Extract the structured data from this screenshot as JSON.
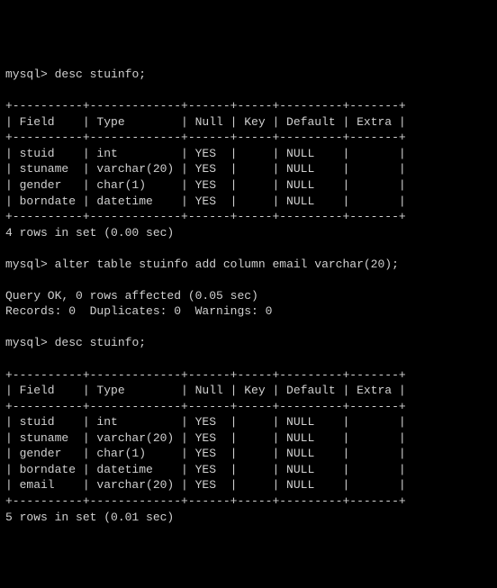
{
  "prompt": "mysql>",
  "commands": {
    "desc1": "desc stuinfo;",
    "alter": "alter table stuinfo add column email varchar(20);",
    "desc2": "desc stuinfo;"
  },
  "table1": {
    "border": "+----------+-------------+------+-----+---------+-------+",
    "header": "| Field    | Type        | Null | Key | Default | Extra |",
    "rows": [
      "| stuid    | int         | YES  |     | NULL    |       |",
      "| stuname  | varchar(20) | YES  |     | NULL    |       |",
      "| gender   | char(1)     | YES  |     | NULL    |       |",
      "| borndate | datetime    | YES  |     | NULL    |       |"
    ]
  },
  "status1": "4 rows in set (0.00 sec)",
  "alter_result": {
    "line1": "Query OK, 0 rows affected (0.05 sec)",
    "line2": "Records: 0  Duplicates: 0  Warnings: 0"
  },
  "table2": {
    "border": "+----------+-------------+------+-----+---------+-------+",
    "header": "| Field    | Type        | Null | Key | Default | Extra |",
    "rows": [
      "| stuid    | int         | YES  |     | NULL    |       |",
      "| stuname  | varchar(20) | YES  |     | NULL    |       |",
      "| gender   | char(1)     | YES  |     | NULL    |       |",
      "| borndate | datetime    | YES  |     | NULL    |       |",
      "| email    | varchar(20) | YES  |     | NULL    |       |"
    ]
  },
  "status2": "5 rows in set (0.01 sec)",
  "chart_data": {
    "type": "table",
    "tables": [
      {
        "title": "desc stuinfo (before alter)",
        "columns": [
          "Field",
          "Type",
          "Null",
          "Key",
          "Default",
          "Extra"
        ],
        "rows": [
          [
            "stuid",
            "int",
            "YES",
            "",
            "NULL",
            ""
          ],
          [
            "stuname",
            "varchar(20)",
            "YES",
            "",
            "NULL",
            ""
          ],
          [
            "gender",
            "char(1)",
            "YES",
            "",
            "NULL",
            ""
          ],
          [
            "borndate",
            "datetime",
            "YES",
            "",
            "NULL",
            ""
          ]
        ]
      },
      {
        "title": "desc stuinfo (after alter)",
        "columns": [
          "Field",
          "Type",
          "Null",
          "Key",
          "Default",
          "Extra"
        ],
        "rows": [
          [
            "stuid",
            "int",
            "YES",
            "",
            "NULL",
            ""
          ],
          [
            "stuname",
            "varchar(20)",
            "YES",
            "",
            "NULL",
            ""
          ],
          [
            "gender",
            "char(1)",
            "YES",
            "",
            "NULL",
            ""
          ],
          [
            "borndate",
            "datetime",
            "YES",
            "",
            "NULL",
            ""
          ],
          [
            "email",
            "varchar(20)",
            "YES",
            "",
            "NULL",
            ""
          ]
        ]
      }
    ]
  }
}
